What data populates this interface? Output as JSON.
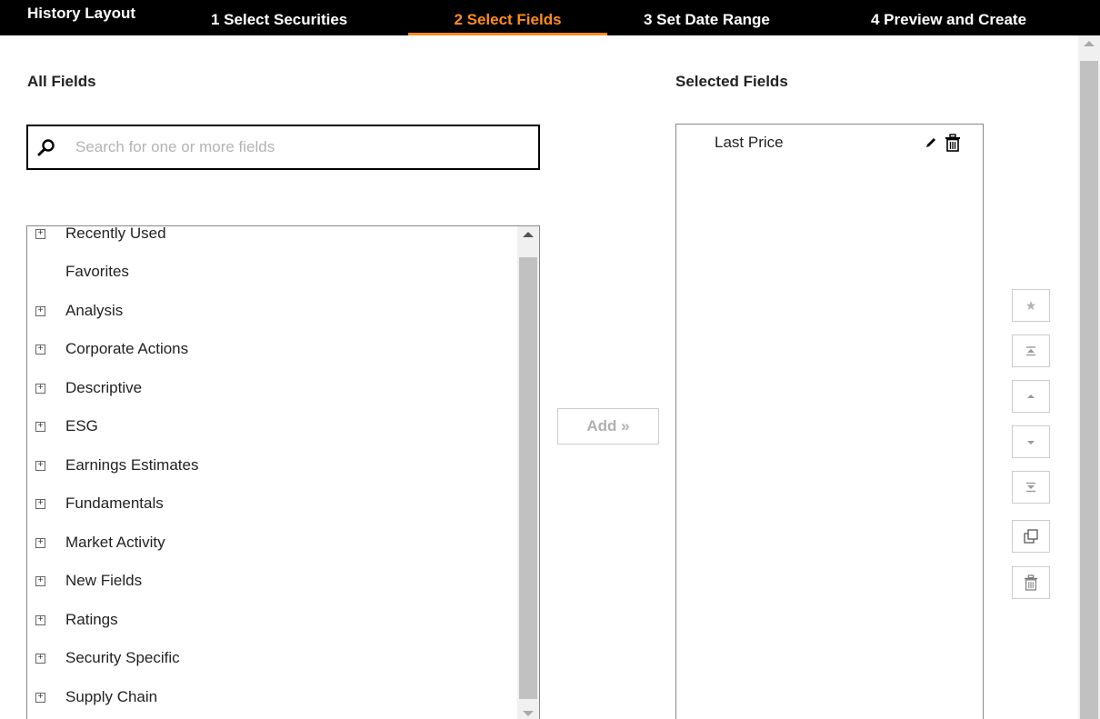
{
  "topbar": {
    "title": "History Layout",
    "steps": [
      {
        "label": "1 Select Securities"
      },
      {
        "label": "2 Select Fields",
        "active": true
      },
      {
        "label": "3 Set Date Range"
      },
      {
        "label": "4 Preview and Create"
      }
    ]
  },
  "all_fields": {
    "title": "All Fields",
    "search_placeholder": "Search for one or more fields",
    "search_value": "",
    "items": [
      {
        "label": "Recently Used",
        "expandable": true
      },
      {
        "label": "Favorites",
        "expandable": false
      },
      {
        "label": "Analysis",
        "expandable": true
      },
      {
        "label": "Corporate Actions",
        "expandable": true
      },
      {
        "label": "Descriptive",
        "expandable": true
      },
      {
        "label": "ESG",
        "expandable": true
      },
      {
        "label": "Earnings Estimates",
        "expandable": true
      },
      {
        "label": "Fundamentals",
        "expandable": true
      },
      {
        "label": "Market Activity",
        "expandable": true
      },
      {
        "label": "New Fields",
        "expandable": true
      },
      {
        "label": "Ratings",
        "expandable": true
      },
      {
        "label": "Security Specific",
        "expandable": true
      },
      {
        "label": "Supply Chain",
        "expandable": true
      }
    ]
  },
  "add_button": {
    "label": "Add »"
  },
  "selected_fields": {
    "title": "Selected Fields",
    "items": [
      {
        "label": "Last Price"
      }
    ]
  },
  "side_actions": [
    {
      "icon": "star-icon"
    },
    {
      "icon": "move-to-top-icon"
    },
    {
      "icon": "move-up-icon"
    },
    {
      "icon": "move-down-icon"
    },
    {
      "icon": "move-to-bottom-icon"
    },
    {
      "icon": "duplicate-icon"
    },
    {
      "icon": "trash-icon"
    }
  ],
  "colors": {
    "topbar_bg": "#000000",
    "active_step": "#ff8c1a"
  }
}
